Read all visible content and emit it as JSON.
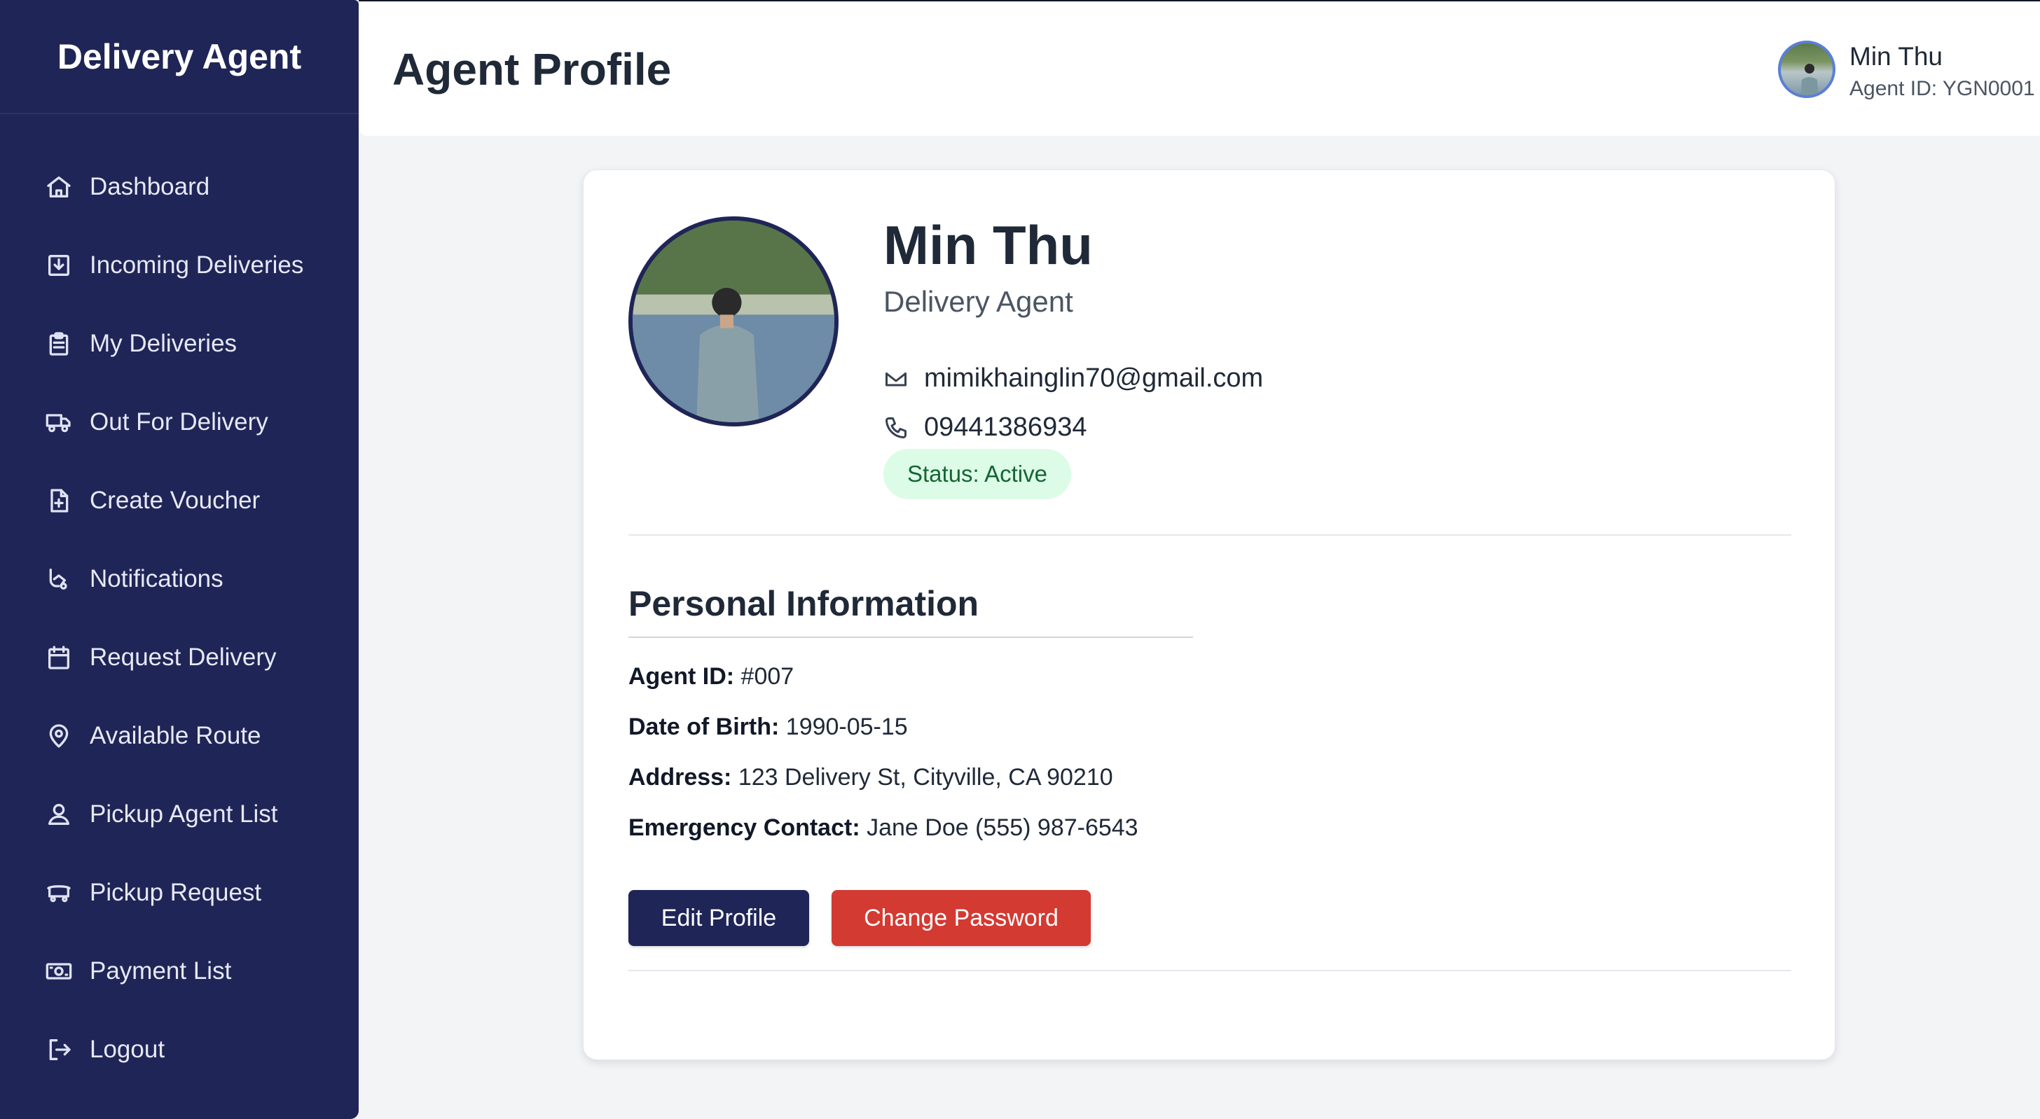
{
  "app": {
    "brand": "Delivery Agent"
  },
  "sidebar": {
    "items": [
      {
        "label": "Dashboard",
        "icon": "home-icon"
      },
      {
        "label": "Incoming Deliveries",
        "icon": "inbox-download-icon"
      },
      {
        "label": "My Deliveries",
        "icon": "clipboard-icon"
      },
      {
        "label": "Out For Delivery",
        "icon": "truck-icon"
      },
      {
        "label": "Create Voucher",
        "icon": "file-plus-icon"
      },
      {
        "label": "Notifications",
        "icon": "bell-hand-icon"
      },
      {
        "label": "Request Delivery",
        "icon": "calendar-icon"
      },
      {
        "label": "Available Route",
        "icon": "map-pin-icon"
      },
      {
        "label": "Pickup Agent List",
        "icon": "user-icon"
      },
      {
        "label": "Pickup Request",
        "icon": "cart-icon"
      },
      {
        "label": "Payment List",
        "icon": "cash-icon"
      },
      {
        "label": "Logout",
        "icon": "logout-icon"
      }
    ]
  },
  "header": {
    "title": "Agent Profile",
    "user": {
      "name": "Min Thu",
      "agent_id": "Agent ID: YGN0001"
    }
  },
  "profile": {
    "name": "Min Thu",
    "role": "Delivery Agent",
    "email": "mimikhainglin70@gmail.com",
    "phone": "09441386934",
    "status": "Status: Active"
  },
  "personal": {
    "title": "Personal Information",
    "agent_id_label": "Agent ID:",
    "agent_id_value": "#007",
    "dob_label": "Date of Birth:",
    "dob_value": "1990-05-15",
    "address_label": "Address:",
    "address_value": "123 Delivery St, Cityville, CA 90210",
    "emergency_label": "Emergency Contact:",
    "emergency_value": "Jane Doe (555) 987-6543"
  },
  "actions": {
    "edit": "Edit Profile",
    "change_password": "Change Password"
  },
  "colors": {
    "sidebar": "#1f2556",
    "primary": "#1f2556",
    "danger": "#d33a32",
    "status_bg": "#dcfce7",
    "status_text": "#166534"
  }
}
